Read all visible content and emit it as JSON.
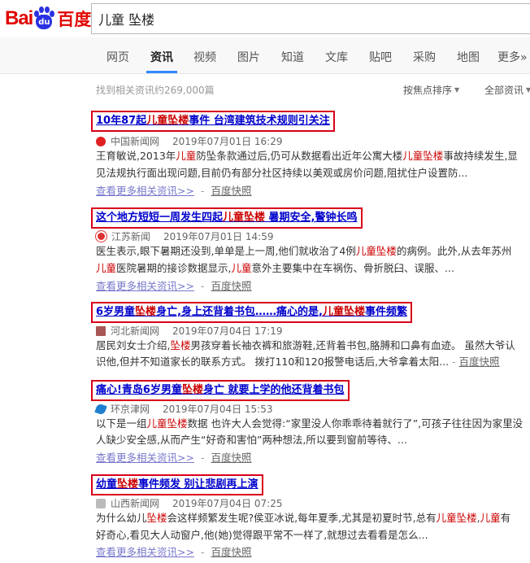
{
  "header": {
    "logo_left": "Bai",
    "logo_paw": "du",
    "logo_right": "百度",
    "query": "儿童 坠楼"
  },
  "nav": {
    "items": [
      "网页",
      "资讯",
      "视频",
      "图片",
      "知道",
      "文库",
      "贴吧",
      "采购",
      "地图",
      "更多»"
    ],
    "active": "资讯"
  },
  "toolbar": {
    "stats": "找到相关资讯约269,000篇",
    "sort": "按焦点排序",
    "filter": "全部资讯"
  },
  "colors": {
    "brand_red": "#e10602",
    "brand_blue": "#2932e1",
    "title_link": "#0000cc",
    "highlight": "#cc0000",
    "title_box": "#d9001b"
  },
  "results": [
    {
      "title": [
        "10年87起",
        "儿童坠楼",
        "事件 台湾建筑技术规则引关注"
      ],
      "source": "中国新闻网",
      "date": "2019年07月01日 16:29",
      "icon": "china-news-icon",
      "abs1": [
        "王育敏说,2013年",
        "儿童",
        "防坠条款通过后,仍可从数据看出近年公寓大楼",
        "儿童坠楼",
        "事故持续发生,显"
      ],
      "abs2": [
        "见法规执行面出现问题,目前仍有部分社区持续以美观或房价问题,阻扰住户设置防..."
      ],
      "more": "查看更多相关资讯>>",
      "snapshot": "百度快照"
    },
    {
      "title": [
        "这个地方短短一周发生四起",
        "儿童坠楼",
        " 暑期安全,警钟长鸣"
      ],
      "source": "江苏新闻",
      "date": "2019年07月01日 14:59",
      "icon": "jiangsu-news-icon",
      "abs1": [
        "医生表示,眼下暑期还没到,单单是上一周,他们就收治了4例",
        "儿童坠楼",
        "的病例。此外,从去年苏州"
      ],
      "abs2": [
        "儿童",
        "医院暑期的接诊数据显示,",
        "儿童",
        "意外主要集中在车祸伤、骨折脱臼、误服、..."
      ],
      "more": "查看更多相关资讯>>",
      "snapshot": "百度快照"
    },
    {
      "title": [
        "6岁男童",
        "坠楼",
        "身亡,身上还背着书包……痛心的是,",
        "儿童坠楼",
        "事件频繁"
      ],
      "source": "河北新闻网",
      "date": "2019年07月04日 17:19",
      "icon": "hebei-news-icon",
      "abs1": [
        "居民刘女士介绍,",
        "坠楼",
        "男孩穿着长袖衣裤和旅游鞋,还背着书包,胳膊和口鼻有血迹。 虽然大爷认"
      ],
      "abs2": [
        "识他,但并不知道家长的联系方式。 拨打110和120报警电话后,大爷拿着太阳..."
      ],
      "more": "",
      "snapshot": "百度快照"
    },
    {
      "title": [
        "痛心!青岛6岁男童",
        "坠楼",
        "身亡 就要上学的他还背着书包"
      ],
      "source": "环京津网",
      "date": "2019年07月04日 15:53",
      "icon": "huanjingjin-icon",
      "abs1": [
        "以下是一组",
        "儿童坠楼",
        "数据 也许大人会觉得:“家里没人你乖乖待着就行了”,可孩子往往因为家里没"
      ],
      "abs2": [
        "人缺少安全感,从而产生“好奇和害怕”两种想法,所以要到窗前等待、..."
      ],
      "more": "查看更多相关资讯>>",
      "snapshot": "百度快照"
    },
    {
      "title": [
        "幼童",
        "坠楼",
        "事件频发 别让悲剧再上演"
      ],
      "source": "山西新闻网",
      "date": "2019年07月04日 07:25",
      "icon": "shanxi-news-icon",
      "abs1": [
        "为什么幼儿",
        "坠楼",
        "会这样频繁发生呢?侯亚冰说,每年夏季,尤其是初夏时节,总有",
        "儿童坠楼",
        ",",
        "儿童",
        "有"
      ],
      "abs2": [
        "好奇心,看见大人动窗户,他(她)觉得跟平常不一样了,就想过去看看是怎么..."
      ],
      "more": "查看更多相关资讯>>",
      "snapshot": "百度快照"
    }
  ]
}
